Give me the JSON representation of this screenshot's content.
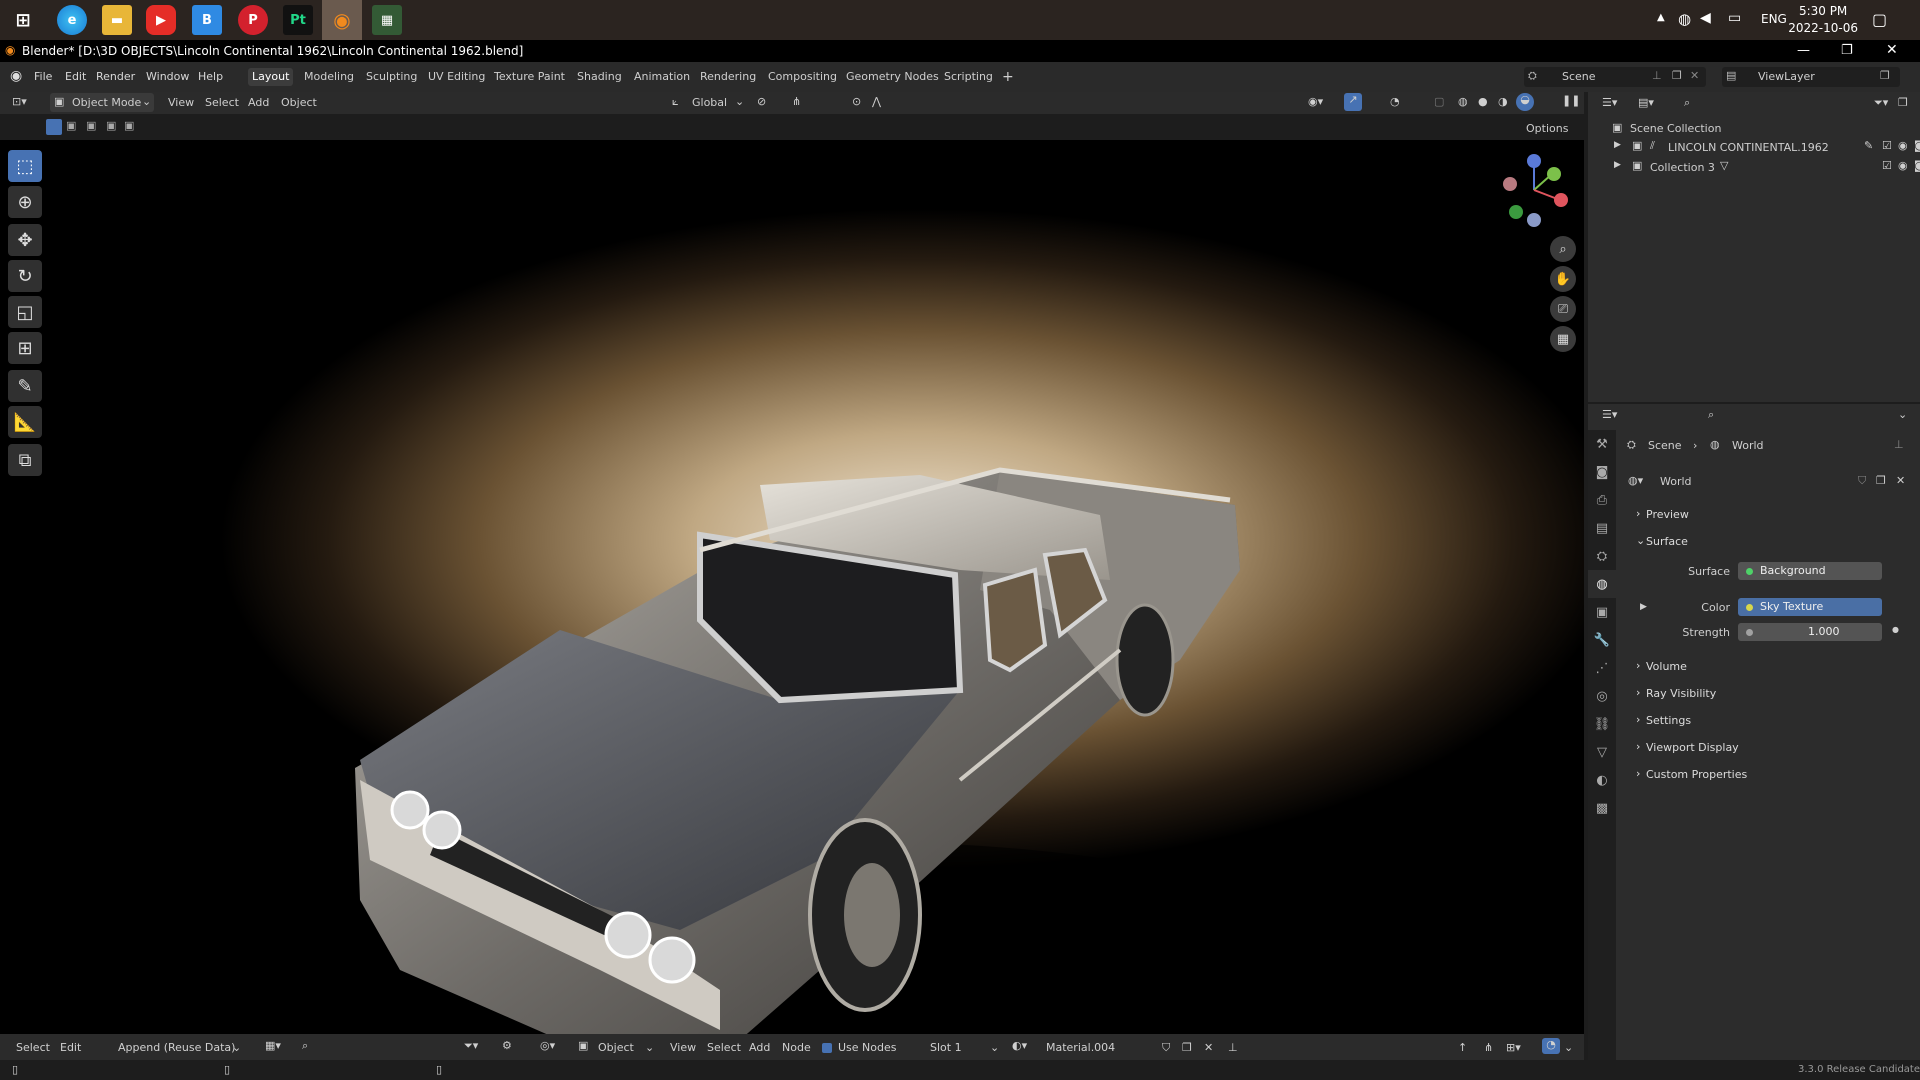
{
  "taskbar": {
    "apps": [
      "windows-start",
      "edge",
      "file-explorer",
      "youtube",
      "blue-app",
      "pinterest",
      "pycharm",
      "blender",
      "game-app"
    ],
    "lang": "ENG",
    "time": "5:30 PM",
    "date": "2022-10-06"
  },
  "window": {
    "title": "Blender* [D:\\3D OBJECTS\\Lincoln Continental 1962\\Lincoln Continental 1962.blend]"
  },
  "menu": {
    "items": [
      "File",
      "Edit",
      "Render",
      "Window",
      "Help"
    ],
    "workspaces": [
      "Layout",
      "Modeling",
      "Sculpting",
      "UV Editing",
      "Texture Paint",
      "Shading",
      "Animation",
      "Rendering",
      "Compositing",
      "Geometry Nodes",
      "Scripting"
    ],
    "active_workspace": "Layout",
    "scene": "Scene",
    "view_layer": "ViewLayer"
  },
  "viewport": {
    "mode": "Object Mode",
    "menus": [
      "View",
      "Select",
      "Add",
      "Object"
    ],
    "transform": "Global",
    "options": "Options"
  },
  "outliner": {
    "root": "Scene Collection",
    "items": [
      "LINCOLN CONTINENTAL.1962",
      "Collection 3"
    ]
  },
  "properties": {
    "breadcrumb": [
      "Scene",
      "World"
    ],
    "world_name": "World",
    "panels": {
      "preview": "Preview",
      "surface": "Surface",
      "surface_label": "Surface",
      "surface_value": "Background",
      "color_label": "Color",
      "color_value": "Sky Texture",
      "strength_label": "Strength",
      "strength_value": "1.000",
      "volume": "Volume",
      "ray_visibility": "Ray Visibility",
      "settings": "Settings",
      "viewport_display": "Viewport Display",
      "custom_properties": "Custom Properties"
    }
  },
  "bottom": {
    "select": "Select",
    "edit": "Edit",
    "append": "Append (Reuse Data)",
    "object": "Object",
    "view": "View",
    "select2": "Select",
    "add": "Add",
    "node": "Node",
    "use_nodes": "Use Nodes",
    "slot": "Slot 1",
    "material": "Material.004"
  },
  "status": {
    "version": "3.3.0 Release Candidate"
  },
  "colors": {
    "accent": "#4772b3",
    "socket_yellow": "#d6d64c",
    "sky_texture_field": "#4a6fa5"
  }
}
